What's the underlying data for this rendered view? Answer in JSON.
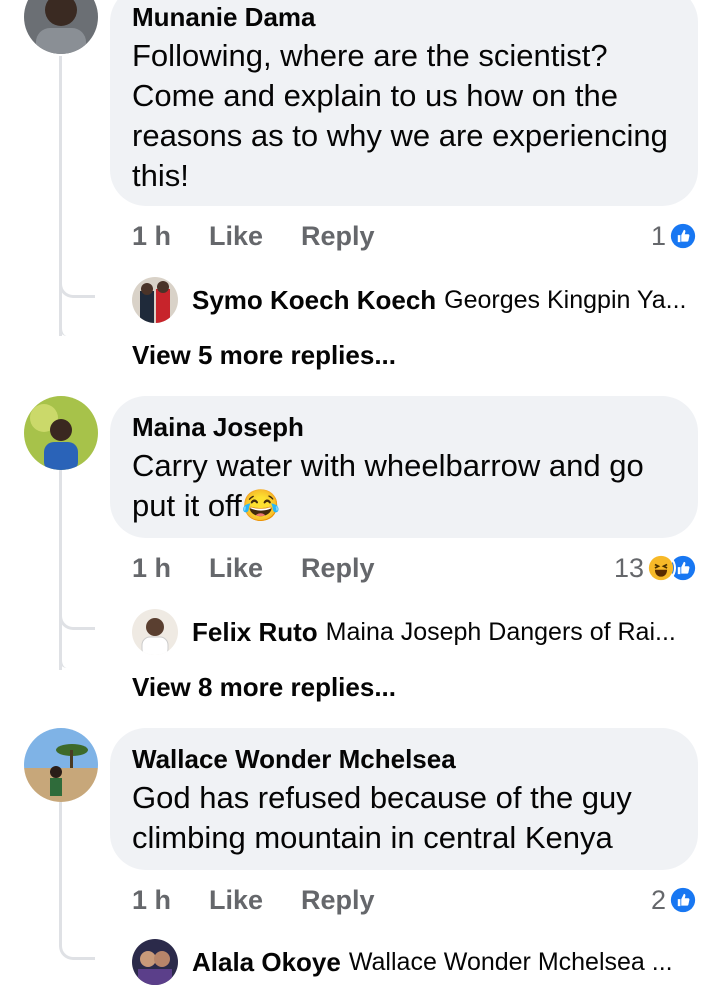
{
  "comments": [
    {
      "author": "Munanie Dama",
      "text": "Following, where are the scientist? Come and explain to us how on the reasons as to why we are experiencing this!",
      "time": "1 h",
      "like_label": "Like",
      "reply_label": "Reply",
      "reaction_count": "1",
      "reactions": [
        "like-icon"
      ],
      "reply_preview": {
        "author": "Symo Koech Koech",
        "text": "Georges Kingpin Ya..."
      },
      "view_more": "View 5 more replies..."
    },
    {
      "author": "Maina Joseph",
      "text": "Carry water with wheelbarrow and go put it off",
      "emoji": "😂",
      "time": "1 h",
      "like_label": "Like",
      "reply_label": "Reply",
      "reaction_count": "13",
      "reactions": [
        "haha-icon",
        "like-icon"
      ],
      "reply_preview": {
        "author": "Felix Ruto",
        "text": "Maina Joseph Dangers of Rai..."
      },
      "view_more": "View 8 more replies..."
    },
    {
      "author": "Wallace Wonder Mchelsea",
      "text": "God has refused because of the guy climbing mountain in central Kenya",
      "time": "1 h",
      "like_label": "Like",
      "reply_label": "Reply",
      "reaction_count": "2",
      "reactions": [
        "like-icon"
      ],
      "reply_preview": {
        "author": "Alala Okoye",
        "text": "Wallace Wonder Mchelsea ..."
      }
    }
  ],
  "colors": {
    "bubble": "#f0f2f5",
    "like_blue": "#1877f2",
    "haha_yellow": "#f7b928",
    "meta_gray": "#65676b"
  }
}
